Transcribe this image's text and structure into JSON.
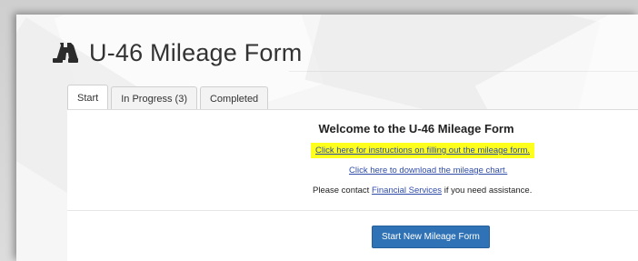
{
  "header": {
    "title": "U-46 Mileage Form",
    "icon": "binoculars-icon"
  },
  "tabs": [
    {
      "label": "Start",
      "active": true
    },
    {
      "label": "In Progress (3)",
      "active": false
    },
    {
      "label": "Completed",
      "active": false
    }
  ],
  "panel": {
    "welcome": "Welcome to the U-46 Mileage Form",
    "instructions_link": "Click here for instructions on filling out the mileage form.",
    "chart_link": "Click here to download the mileage chart.",
    "contact_prefix": "Please contact ",
    "contact_link": "Financial Services",
    "contact_suffix": " if you need assistance.",
    "start_button": "Start New Mileage Form"
  },
  "colors": {
    "highlight": "#ffff1e",
    "link": "#2e4ba8",
    "button": "#2f72b5"
  }
}
